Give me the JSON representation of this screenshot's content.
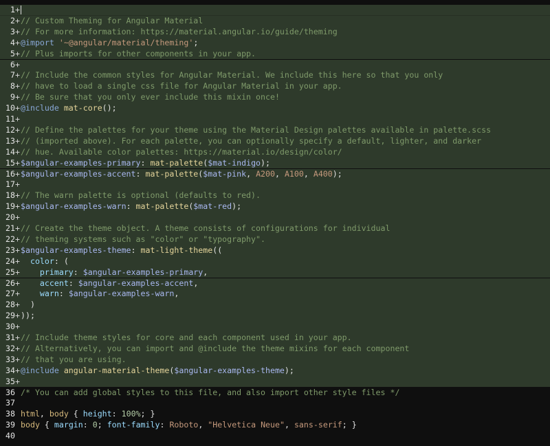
{
  "editor": {
    "lines": [
      {
        "num": "1",
        "marker": "+",
        "added": true,
        "text": ""
      },
      {
        "num": "2",
        "marker": "+",
        "added": true,
        "text": "// Custom Theming for Angular Material"
      },
      {
        "num": "3",
        "marker": "+",
        "added": true,
        "text": "// For more information: https://material.angular.io/guide/theming"
      },
      {
        "num": "4",
        "marker": "+",
        "added": true,
        "text": "@import '~@angular/material/theming';"
      },
      {
        "num": "5",
        "marker": "+",
        "added": true,
        "text": "// Plus imports for other components in your app."
      },
      {
        "num": "6",
        "marker": "+",
        "added": true,
        "text": ""
      },
      {
        "num": "7",
        "marker": "+",
        "added": true,
        "text": "// Include the common styles for Angular Material. We include this here so that you only"
      },
      {
        "num": "8",
        "marker": "+",
        "added": true,
        "text": "// have to load a single css file for Angular Material in your app."
      },
      {
        "num": "9",
        "marker": "+",
        "added": true,
        "text": "// Be sure that you only ever include this mixin once!"
      },
      {
        "num": "10",
        "marker": "+",
        "added": true,
        "text": "@include mat-core();"
      },
      {
        "num": "11",
        "marker": "+",
        "added": true,
        "text": ""
      },
      {
        "num": "12",
        "marker": "+",
        "added": true,
        "text": "// Define the palettes for your theme using the Material Design palettes available in palette.scss"
      },
      {
        "num": "13",
        "marker": "+",
        "added": true,
        "text": "// (imported above). For each palette, you can optionally specify a default, lighter, and darker"
      },
      {
        "num": "14",
        "marker": "+",
        "added": true,
        "text": "// hue. Available color palettes: https://material.io/design/color/"
      },
      {
        "num": "15",
        "marker": "+",
        "added": true,
        "text": "$angular-examples-primary: mat-palette($mat-indigo);"
      },
      {
        "num": "16",
        "marker": "+",
        "added": true,
        "text": "$angular-examples-accent: mat-palette($mat-pink, A200, A100, A400);"
      },
      {
        "num": "17",
        "marker": "+",
        "added": true,
        "text": ""
      },
      {
        "num": "18",
        "marker": "+",
        "added": true,
        "text": "// The warn palette is optional (defaults to red)."
      },
      {
        "num": "19",
        "marker": "+",
        "added": true,
        "text": "$angular-examples-warn: mat-palette($mat-red);"
      },
      {
        "num": "20",
        "marker": "+",
        "added": true,
        "text": ""
      },
      {
        "num": "21",
        "marker": "+",
        "added": true,
        "text": "// Create the theme object. A theme consists of configurations for individual"
      },
      {
        "num": "22",
        "marker": "+",
        "added": true,
        "text": "// theming systems such as \"color\" or \"typography\"."
      },
      {
        "num": "23",
        "marker": "+",
        "added": true,
        "text": "$angular-examples-theme: mat-light-theme(("
      },
      {
        "num": "24",
        "marker": "+",
        "added": true,
        "text": "  color: ("
      },
      {
        "num": "25",
        "marker": "+",
        "added": true,
        "text": "    primary: $angular-examples-primary,"
      },
      {
        "num": "26",
        "marker": "+",
        "added": true,
        "text": "    accent: $angular-examples-accent,"
      },
      {
        "num": "27",
        "marker": "+",
        "added": true,
        "text": "    warn: $angular-examples-warn,"
      },
      {
        "num": "28",
        "marker": "+",
        "added": true,
        "text": "  )"
      },
      {
        "num": "29",
        "marker": "+",
        "added": true,
        "text": "));"
      },
      {
        "num": "30",
        "marker": "+",
        "added": true,
        "text": ""
      },
      {
        "num": "31",
        "marker": "+",
        "added": true,
        "text": "// Include theme styles for core and each component used in your app."
      },
      {
        "num": "32",
        "marker": "+",
        "added": true,
        "text": "// Alternatively, you can import and @include the theme mixins for each component"
      },
      {
        "num": "33",
        "marker": "+",
        "added": true,
        "text": "// that you are using."
      },
      {
        "num": "34",
        "marker": "+",
        "added": true,
        "text": "@include angular-material-theme($angular-examples-theme);"
      },
      {
        "num": "35",
        "marker": "+",
        "added": true,
        "text": ""
      },
      {
        "num": "36",
        "marker": "",
        "added": false,
        "text": "/* You can add global styles to this file, and also import other style files */"
      },
      {
        "num": "37",
        "marker": "",
        "added": false,
        "text": ""
      },
      {
        "num": "38",
        "marker": "",
        "added": false,
        "text": "html, body { height: 100%; }"
      },
      {
        "num": "39",
        "marker": "",
        "added": false,
        "text": "body { margin: 0; font-family: Roboto, \"Helvetica Neue\", sans-serif; }"
      },
      {
        "num": "40",
        "marker": "",
        "added": false,
        "text": ""
      }
    ],
    "colors": {
      "background": "#0f0f0f",
      "added_line_background": "#2e3a2b",
      "comment": "#7f9a6a",
      "keyword": "#8aa8d8",
      "variable": "#a9b8f0",
      "string": "#c69a7d",
      "function": "#e4d49a"
    }
  }
}
